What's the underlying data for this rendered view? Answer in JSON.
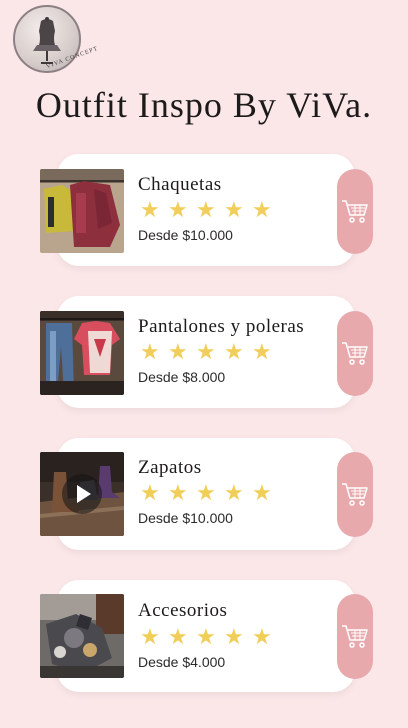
{
  "brand": {
    "logo_text": "VIVA CONCEPT"
  },
  "header": {
    "title": "Outfit Inspo By ViVa."
  },
  "categories": [
    {
      "name": "Chaquetas",
      "price": "Desde $10.000",
      "rating_stars": 5,
      "media": "photo",
      "thumb_icon": "jackets-photo"
    },
    {
      "name": "Pantalones y poleras",
      "price": "Desde $8.000",
      "rating_stars": 5,
      "media": "photo",
      "thumb_icon": "pants-shirts-photo"
    },
    {
      "name": "Zapatos",
      "price": "Desde $10.000",
      "rating_stars": 5,
      "media": "video",
      "thumb_icon": "shoes-video"
    },
    {
      "name": "Accesorios",
      "price": "Desde $4.000",
      "rating_stars": 5,
      "media": "photo",
      "thumb_icon": "accessories-photo"
    }
  ],
  "star_glyph": "★",
  "cart_icon": "shopping-cart-icon",
  "colors": {
    "background": "#fbe7e8",
    "card": "#ffffff",
    "cart_button": "#e8a9ad",
    "star": "#f1ce5a",
    "text": "#1c1a1a"
  }
}
